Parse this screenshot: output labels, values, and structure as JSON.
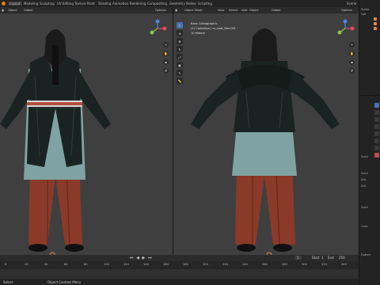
{
  "menu": {
    "items": [
      "Layout",
      "Modeling",
      "Sculpting",
      "UV Editing",
      "Texture Paint",
      "Shading",
      "Animation",
      "Rendering",
      "Compositing",
      "Geometry Nodes",
      "Scripting"
    ],
    "scene_label": "Scene"
  },
  "left_view": {
    "header": {
      "mode": "Object",
      "transform": "Global",
      "options": "Options"
    }
  },
  "right_view": {
    "header": {
      "mode": "Object Mode",
      "view": "View",
      "select": "Select",
      "add": "Add",
      "object": "Object",
      "transform": "Global",
      "options": "Options"
    },
    "overlay": {
      "title": "Back Orthographic",
      "collection": "(1) Collection | m_coat_firm203",
      "scale": "10 Meters"
    }
  },
  "timeline": {
    "ticks": [
      "0",
      "20",
      "40",
      "60",
      "80",
      "100",
      "120",
      "140",
      "160",
      "180",
      "200",
      "220",
      "240",
      "260",
      "280",
      "300",
      "320",
      "340"
    ],
    "current_frame": "1",
    "start_label": "Start",
    "start_value": "1",
    "end_label": "End",
    "end_value": "250"
  },
  "status": {
    "left": "Select",
    "center": "Object Context Menu"
  },
  "right_panel": {
    "outliner_rows": [
      "Scene",
      "Coll",
      "",
      "",
      "",
      ""
    ],
    "labels": [
      "Subd",
      "Subd",
      "Sub",
      "Sub",
      "Subd",
      "Color",
      "Flatten"
    ]
  },
  "colors": {
    "accent": "#4772b3",
    "viewport_bg": "#3f3f3f",
    "coat": "#1a2321",
    "shirt": "#7fa3a2",
    "pants": "#8b3a2a",
    "x_axis": "#e04a5c",
    "y_axis": "#8bc34a",
    "z_axis": "#4a86e8"
  }
}
